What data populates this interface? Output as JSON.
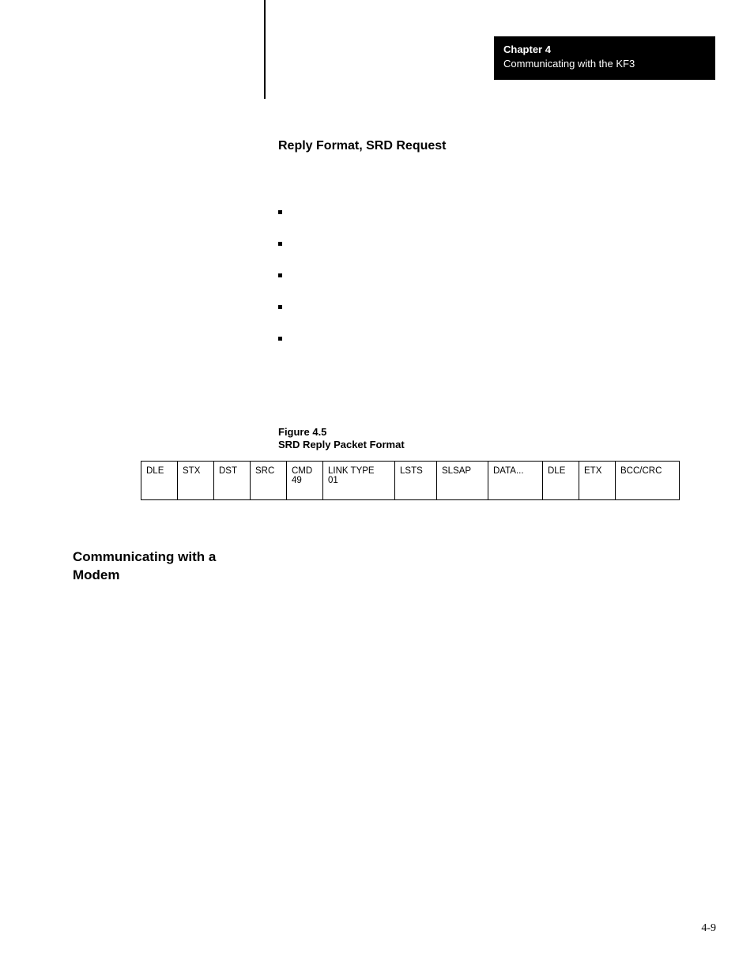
{
  "header": {
    "chapter": "Chapter 4",
    "title": "Communicating with the KF3"
  },
  "section_title": "Reply Format, SRD Request",
  "figure": {
    "number": "Figure 4.5",
    "title": "SRD Reply Packet Format"
  },
  "packet_fields": [
    {
      "line1": "DLE",
      "line2": ""
    },
    {
      "line1": "STX",
      "line2": ""
    },
    {
      "line1": "DST",
      "line2": ""
    },
    {
      "line1": "SRC",
      "line2": ""
    },
    {
      "line1": "CMD",
      "line2": "49"
    },
    {
      "line1": "LINK TYPE",
      "line2": "01"
    },
    {
      "line1": "LSTS",
      "line2": ""
    },
    {
      "line1": "SLSAP",
      "line2": ""
    },
    {
      "line1": "DATA...",
      "line2": ""
    },
    {
      "line1": "DLE",
      "line2": ""
    },
    {
      "line1": "ETX",
      "line2": ""
    },
    {
      "line1": "BCC/CRC",
      "line2": ""
    }
  ],
  "left_heading": {
    "line1": "Communicating with a",
    "line2": "Modem"
  },
  "page_number": "4-9"
}
